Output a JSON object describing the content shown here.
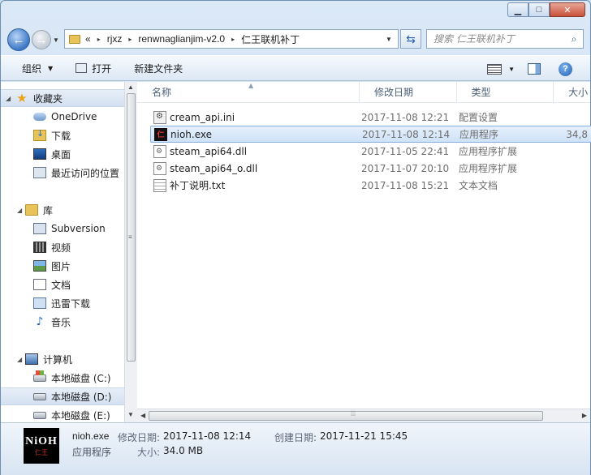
{
  "window": {
    "min_icon": "minimize-icon",
    "max_icon": "maximize-icon",
    "close_icon": "close-icon"
  },
  "nav": {
    "breadcrumb": [
      "«",
      "rjxz",
      "renwnaglianjim-v2.0",
      "仁王联机补丁"
    ],
    "search_placeholder": "搜索 仁王联机补丁"
  },
  "toolbar": {
    "organize": "组织",
    "open": "打开",
    "new_folder": "新建文件夹"
  },
  "sidebar": {
    "favorites": "收藏夹",
    "onedrive": "OneDrive",
    "downloads": "下载",
    "desktop": "桌面",
    "recent": "最近访问的位置",
    "libraries": "库",
    "subversion": "Subversion",
    "videos": "视频",
    "pictures": "图片",
    "documents": "文档",
    "thunder": "迅雷下载",
    "music": "音乐",
    "computer": "计算机",
    "drive_c": "本地磁盘 (C:)",
    "drive_d": "本地磁盘 (D:)",
    "drive_e": "本地磁盘 (E:)"
  },
  "columns": {
    "name": "名称",
    "modified": "修改日期",
    "type": "类型",
    "size": "大小"
  },
  "files": [
    {
      "name": "cream_api.ini",
      "modified": "2017-11-08 12:21",
      "type": "配置设置",
      "size": "",
      "icon": "ini-file-icon"
    },
    {
      "name": "nioh.exe",
      "modified": "2017-11-08 12:14",
      "type": "应用程序",
      "size": "34,8",
      "icon": "exe-file-icon"
    },
    {
      "name": "steam_api64.dll",
      "modified": "2017-11-05 22:41",
      "type": "应用程序扩展",
      "size": "",
      "icon": "dll-file-icon"
    },
    {
      "name": "steam_api64_o.dll",
      "modified": "2017-11-07 20:10",
      "type": "应用程序扩展",
      "size": "",
      "icon": "dll-file-icon"
    },
    {
      "name": "补丁说明.txt",
      "modified": "2017-11-08 15:21",
      "type": "文本文档",
      "size": "",
      "icon": "txt-file-icon"
    }
  ],
  "details": {
    "name": "nioh.exe",
    "type": "应用程序",
    "modified_label": "修改日期:",
    "modified_value": "2017-11-08 12:14",
    "created_label": "创建日期:",
    "created_value": "2017-11-21 15:45",
    "size_label": "大小:",
    "size_value": "34.0 MB",
    "thumb_line1": "NiOH",
    "thumb_line2": "仁王"
  }
}
